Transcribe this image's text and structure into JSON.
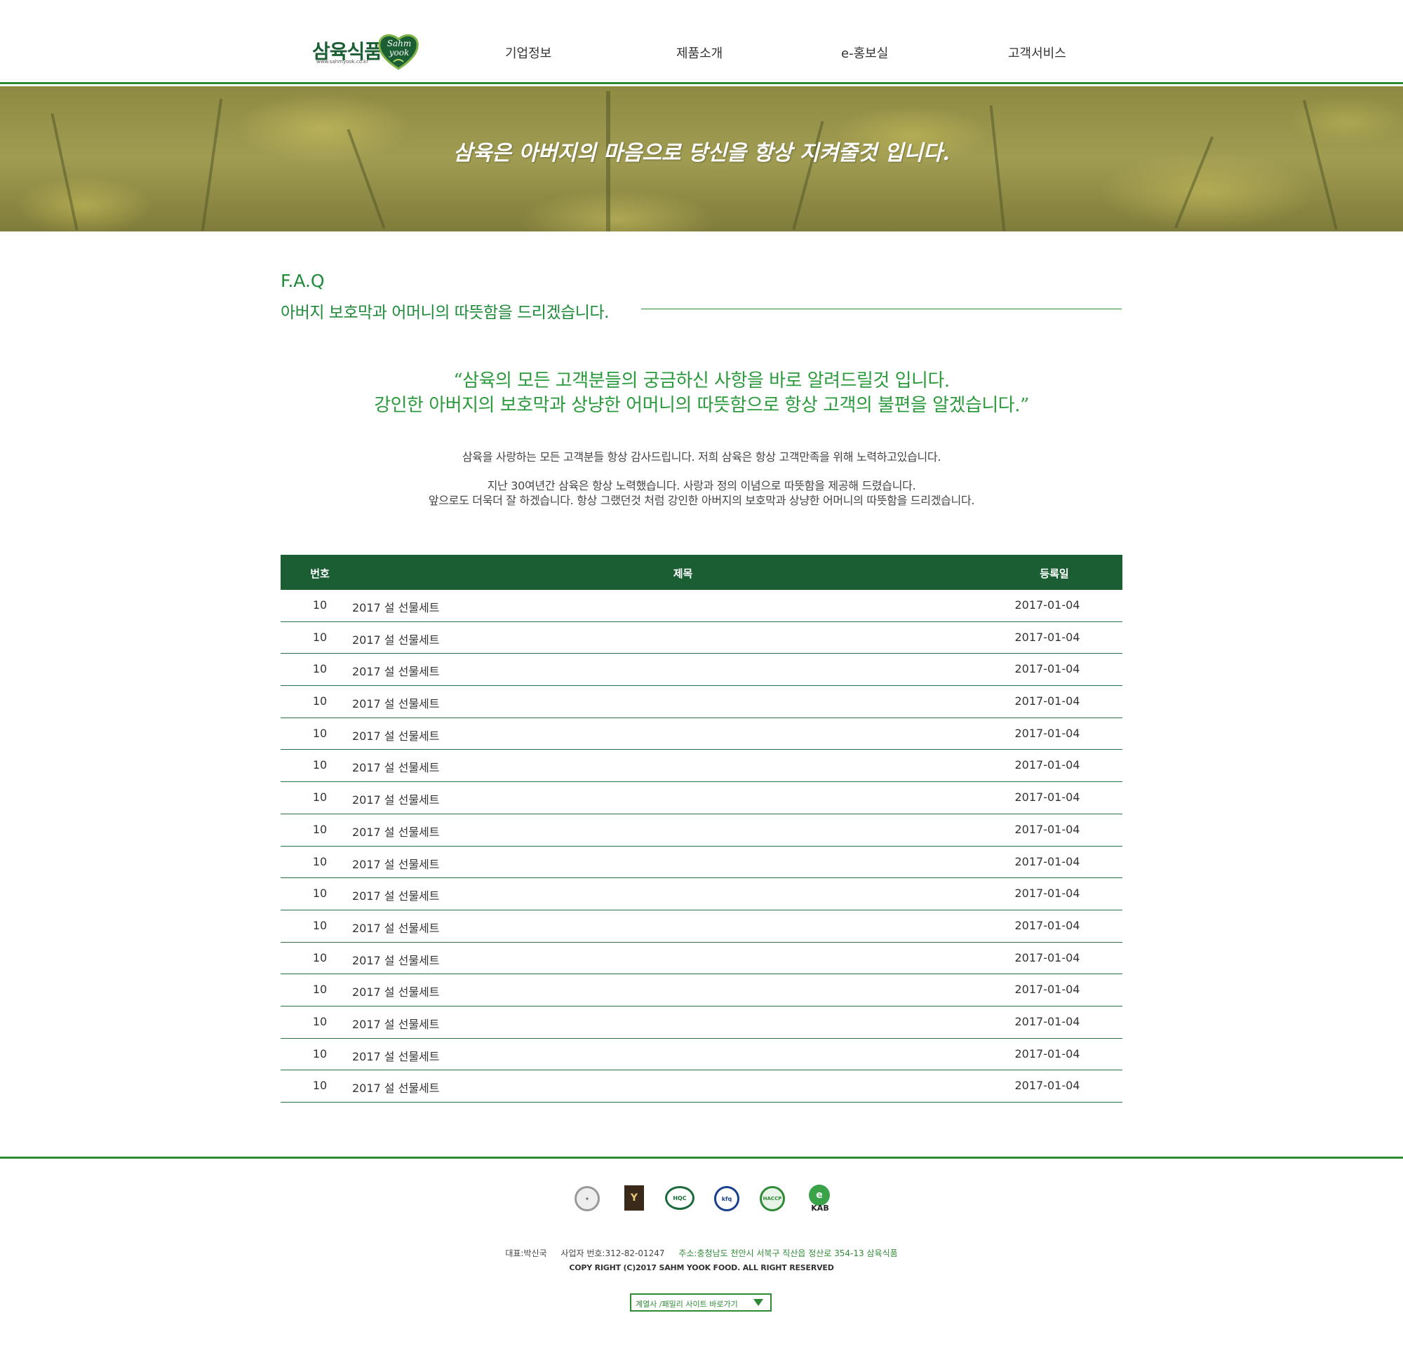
{
  "brand": {
    "name_ko": "삼육식품",
    "url": "www.sahmyook.co.kr",
    "emblem_text": "Sahm yook"
  },
  "nav": [
    "기업정보",
    "제품소개",
    "e-홍보실",
    "고객서비스"
  ],
  "banner": {
    "text": "삼육은 아버지의 마음으로 당신을 항상 지켜줄것 입니다."
  },
  "section": {
    "title": "F.A.Q",
    "subtitle": "아버지 보호막과 어머니의 따뜻함을 드리겠습니다."
  },
  "quote": [
    "“삼육의 모든 고객분들의 궁금하신 사항을 바로 알려드릴것 입니다.",
    "강인한 아버지의 보호막과 상냥한 어머니의 따뜻함으로 항상 고객의 불편을 알겠습니다.”"
  ],
  "intro": [
    "삼육을 사랑하는 모든 고객분들 항상 감사드립니다. 저희 삼육은 항상 고객만족을 위해 노력하고있습니다.",
    "지난 30여년간 삼육은 항상 노력했습니다. 사랑과 정의 이념으로 따뜻함을 제공해 드렸습니다.",
    "앞으로도 더욱더 잘 하겠습니다. 항상 그랬던것 처럼 강인한 아버지의 보호막과 상냥한 어머니의 따뜻함을 드리겠습니다."
  ],
  "table": {
    "headers": {
      "num": "번호",
      "title": "제목",
      "date": "등록일"
    },
    "rows": [
      {
        "num": "10",
        "title": "2017 설 선물세트",
        "date": "2017-01-04"
      },
      {
        "num": "10",
        "title": "2017 설 선물세트",
        "date": "2017-01-04"
      },
      {
        "num": "10",
        "title": "2017 설 선물세트",
        "date": "2017-01-04"
      },
      {
        "num": "10",
        "title": "2017 설 선물세트",
        "date": "2017-01-04"
      },
      {
        "num": "10",
        "title": "2017 설 선물세트",
        "date": "2017-01-04"
      },
      {
        "num": "10",
        "title": "2017 설 선물세트",
        "date": "2017-01-04"
      },
      {
        "num": "10",
        "title": "2017 설 선물세트",
        "date": "2017-01-04"
      },
      {
        "num": "10",
        "title": "2017 설 선물세트",
        "date": "2017-01-04"
      },
      {
        "num": "10",
        "title": "2017 설 선물세트",
        "date": "2017-01-04"
      },
      {
        "num": "10",
        "title": "2017 설 선물세트",
        "date": "2017-01-04"
      },
      {
        "num": "10",
        "title": "2017 설 선물세트",
        "date": "2017-01-04"
      },
      {
        "num": "10",
        "title": "2017 설 선물세트",
        "date": "2017-01-04"
      },
      {
        "num": "10",
        "title": "2017 설 선물세트",
        "date": "2017-01-04"
      },
      {
        "num": "10",
        "title": "2017 설 선물세트",
        "date": "2017-01-04"
      },
      {
        "num": "10",
        "title": "2017 설 선물세트",
        "date": "2017-01-04"
      },
      {
        "num": "10",
        "title": "2017 설 선물세트",
        "date": "2017-01-04"
      }
    ]
  },
  "footer": {
    "certs": [
      "certification-seal-icon",
      "brand-award-icon",
      "hqc-mark-icon",
      "kfq-mark-icon",
      "haccp-mark-icon",
      "kab-mark-icon"
    ],
    "cert_labels": {
      "brand": "BRAND",
      "hqc": "HQC",
      "kfq": "kfq",
      "haccp": "HACCP",
      "kab": "KAB"
    },
    "ceo": "대표:박신국",
    "biz_no": "사업자 번호:312-82-01247",
    "address": "주소:충청남도 천안시 서북구 직산읍 정산로 354-13 삼육식품",
    "copyright": "COPY RIGHT (C)2017 SAHM YOOK FOOD. ALL RIGHT RESERVED",
    "family_site": "계열사 /패밀리 사이트 바로가기"
  },
  "colors": {
    "brand_green": "#1b5e34",
    "accent_green": "#2f8a36",
    "quote_green": "#2a9a3c"
  }
}
